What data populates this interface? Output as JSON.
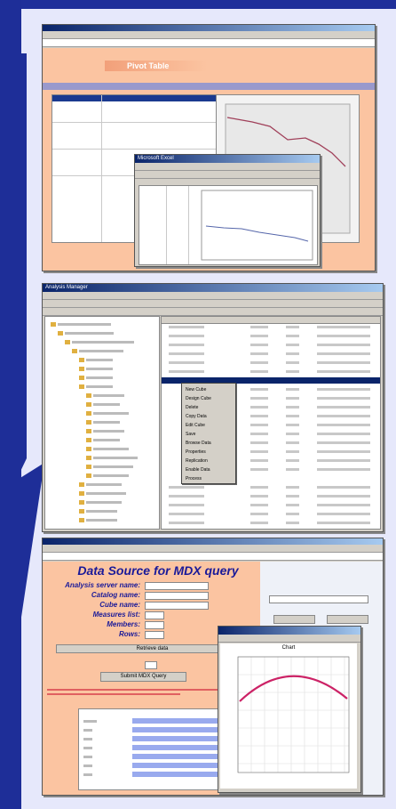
{
  "slide": {
    "screens": [
      {
        "name": "excel-chart-screen",
        "banner": "Pivot Table",
        "window_title": "Microsoft Excel"
      },
      {
        "name": "analysis-manager-screen",
        "window_title": "Analysis Manager",
        "context_menu": [
          "New Cube",
          "Design Cube",
          "Delete",
          "Copy Data",
          "Edit Cube",
          "Save",
          "Browse Data",
          "Properties",
          "Replication",
          "Enable Data",
          "Process"
        ]
      },
      {
        "name": "mdx-query-screen",
        "title": "Data Source for MDX query",
        "fields": [
          {
            "label": "Analysis server name:"
          },
          {
            "label": "Catalog name:"
          },
          {
            "label": "Cube name:"
          },
          {
            "label": "Measures list:"
          },
          {
            "label": "Members:"
          },
          {
            "label": "Rows:"
          }
        ],
        "buttons": [
          "Retrieve data",
          "Submit MDX Query"
        ],
        "chart_title": "Chart"
      }
    ]
  },
  "colors": {
    "frame": "#1e2e98",
    "panel": "#e6e8fb",
    "accent": "#fbc4a1",
    "title_text": "#1a1a99"
  }
}
